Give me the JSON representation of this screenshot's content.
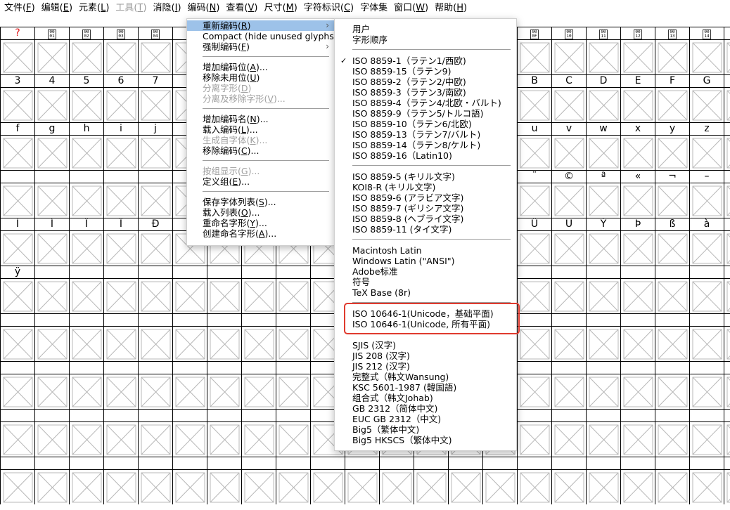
{
  "menubar": [
    {
      "label": "文件(",
      "key": "F",
      "tail": ")",
      "disabled": false
    },
    {
      "label": "编辑(",
      "key": "E",
      "tail": ")",
      "disabled": false
    },
    {
      "label": "元素(",
      "key": "L",
      "tail": ")",
      "disabled": false
    },
    {
      "label": "工具(",
      "key": "T",
      "tail": ")",
      "disabled": true
    },
    {
      "label": "消隐(",
      "key": "I",
      "tail": ")",
      "disabled": false
    },
    {
      "label": "编码(",
      "key": "N",
      "tail": ")",
      "disabled": false
    },
    {
      "label": "查看(",
      "key": "V",
      "tail": ")",
      "disabled": false
    },
    {
      "label": "尺寸(",
      "key": "M",
      "tail": ")",
      "disabled": false
    },
    {
      "label": "字符标识(",
      "key": "C",
      "tail": ")",
      "disabled": false
    },
    {
      "label": "字体集",
      "key": "",
      "tail": "",
      "disabled": false
    },
    {
      "label": "窗口(",
      "key": "W",
      "tail": ")",
      "disabled": false
    },
    {
      "label": "帮助(",
      "key": "H",
      "tail": ")",
      "disabled": false
    }
  ],
  "grid_rows": [
    [
      "?",
      "▯00\n01",
      "▯00\n02",
      "▯00\n03",
      "▯00\n04",
      "",
      "",
      "",
      "",
      "",
      "",
      "",
      "",
      "",
      "",
      "▯00\n0F",
      "▯00\n10",
      "▯00\n11",
      "▯00\n12",
      "▯00\n13",
      "▯00\n14"
    ],
    [
      "3",
      "4",
      "5",
      "6",
      "7",
      "",
      "",
      "",
      "",
      "",
      "",
      "",
      "",
      "",
      "",
      "B",
      "C",
      "D",
      "E",
      "F",
      "G"
    ],
    [
      "f",
      "g",
      "h",
      "i",
      "j",
      "",
      "",
      "",
      "",
      "",
      "",
      "",
      "",
      "",
      "",
      "u",
      "v",
      "w",
      "x",
      "y",
      "z"
    ],
    [
      "",
      "",
      "",
      "",
      "",
      "",
      "",
      "",
      "",
      "",
      "",
      "",
      "",
      "",
      "",
      "¨",
      "©",
      "ª",
      "«",
      "¬",
      "–"
    ],
    [
      "Ì",
      "Í",
      "Î",
      "Ï",
      "Ð",
      "",
      "",
      "",
      "",
      "",
      "",
      "",
      "",
      "",
      "",
      "Û",
      "Ü",
      "Ý",
      "Þ",
      "ß",
      "à"
    ],
    [
      "ÿ",
      "",
      "",
      "",
      "",
      "",
      "",
      "",
      "",
      "",
      "",
      "",
      "",
      "",
      "",
      "",
      "",
      "",
      "",
      "",
      ""
    ],
    [
      "",
      "",
      "",
      "",
      "",
      "",
      "",
      "",
      "",
      "",
      "",
      "",
      "",
      "",
      "",
      "",
      "",
      "",
      "",
      "",
      ""
    ],
    [
      "",
      "",
      "",
      "",
      "",
      "",
      "",
      "",
      "",
      "",
      "",
      "",
      "",
      "",
      "",
      "",
      "",
      "",
      "",
      "",
      ""
    ],
    [
      "",
      "",
      "",
      "",
      "",
      "",
      "",
      "",
      "",
      "",
      "",
      "",
      "",
      "",
      "",
      "",
      "",
      "",
      "",
      "",
      ""
    ],
    [
      "",
      "",
      "",
      "",
      "",
      "",
      "",
      "",
      "",
      "",
      "",
      "",
      "",
      "",
      "",
      "",
      "",
      "",
      "",
      "",
      ""
    ]
  ],
  "grid_first_red": "?",
  "encoding_menu": [
    {
      "label": "重新编码(",
      "key": "R",
      "tail": ")",
      "submenu": true,
      "highlight": true,
      "disabled": false
    },
    {
      "label": "Compact (hide unused glyphs)",
      "key": "",
      "tail": "",
      "submenu": false,
      "highlight": false,
      "disabled": false
    },
    {
      "label": "强制编码(",
      "key": "F",
      "tail": ")",
      "submenu": true,
      "highlight": false,
      "disabled": false
    },
    {
      "sep": true
    },
    {
      "label": "增加编码位(",
      "key": "A",
      "tail": ")...",
      "disabled": false
    },
    {
      "label": "移除未用位(",
      "key": "U",
      "tail": ")",
      "disabled": false
    },
    {
      "label": "分离字形(",
      "key": "D",
      "tail": ")",
      "disabled": true
    },
    {
      "label": "分离及移除字形(",
      "key": "V",
      "tail": ")...",
      "disabled": true
    },
    {
      "sep": true
    },
    {
      "label": "增加编码名(",
      "key": "N",
      "tail": ")...",
      "disabled": false
    },
    {
      "label": "载入编码(",
      "key": "L",
      "tail": ")...",
      "disabled": false
    },
    {
      "label": "生成自字体(",
      "key": "K",
      "tail": ")...",
      "disabled": true
    },
    {
      "label": "移除编码(",
      "key": "C",
      "tail": ")...",
      "disabled": false
    },
    {
      "sep": true
    },
    {
      "label": "按组显示(",
      "key": "G",
      "tail": ")...",
      "disabled": true
    },
    {
      "label": "定义组(",
      "key": "E",
      "tail": ")...",
      "disabled": false
    },
    {
      "sep": true
    },
    {
      "label": "保存字体列表(",
      "key": "S",
      "tail": ")...",
      "disabled": false
    },
    {
      "label": "载入列表(",
      "key": "O",
      "tail": ")...",
      "disabled": false
    },
    {
      "label": "重命名字形(",
      "key": "Y",
      "tail": ")...",
      "disabled": false
    },
    {
      "label": "创建命名字形(",
      "key": "A",
      "tail": ")...",
      "disabled": false
    }
  ],
  "reencode_submenu": [
    {
      "label": "用户"
    },
    {
      "label": "字形顺序"
    },
    {
      "sep": true
    },
    {
      "label": "ISO 8859-1（ラテン1/西欧)",
      "checked": true
    },
    {
      "label": "ISO 8859-15（ラテン9)"
    },
    {
      "label": "ISO 8859-2（ラテン2/中欧)"
    },
    {
      "label": "ISO 8859-3（ラテン3/南欧)"
    },
    {
      "label": "ISO 8859-4（ラテン4/北欧・バルト)"
    },
    {
      "label": "ISO 8859-9（ラテン5/トルコ語)"
    },
    {
      "label": "ISO 8859-10（ラテン6/北欧)"
    },
    {
      "label": "ISO 8859-13（ラテン7/バルト)"
    },
    {
      "label": "ISO 8859-14（ラテン8/ケルト)"
    },
    {
      "label": "ISO 8859-16（Latin10)"
    },
    {
      "sep": true
    },
    {
      "label": "ISO 8859-5 (キリル文字)"
    },
    {
      "label": "KOI8-R (キリル文字)"
    },
    {
      "label": "ISO 8859-6 (アラビア文字)"
    },
    {
      "label": "ISO 8859-7 (ギリシア文字)"
    },
    {
      "label": "ISO 8859-8 (ヘブライ文字)"
    },
    {
      "label": "ISO 8859-11 (タイ文字)"
    },
    {
      "sep": true
    },
    {
      "label": "Macintosh Latin"
    },
    {
      "label": "Windows Latin (\"ANSI\")"
    },
    {
      "label": "Adobe标准"
    },
    {
      "label": "符号"
    },
    {
      "label": "TeX Base (8r)"
    },
    {
      "sep": true
    },
    {
      "label": "ISO 10646-1(Unicode，基础平面)"
    },
    {
      "label": "ISO 10646-1(Unicode, 所有平面)"
    },
    {
      "sep": true
    },
    {
      "label": "SJIS (汉字)"
    },
    {
      "label": "JIS 208 (汉字)"
    },
    {
      "label": "JIS 212 (汉字)"
    },
    {
      "label": "完整式（韩文Wansung)"
    },
    {
      "label": "KSC 5601-1987 (韓国語)"
    },
    {
      "label": "组合式（韩文Johab)"
    },
    {
      "label": "GB 2312（简体中文)"
    },
    {
      "label": "EUC GB 2312（中文)"
    },
    {
      "label": "Big5（繁体中文)"
    },
    {
      "label": "Big5 HKSCS（繁体中文)"
    }
  ],
  "colors": {
    "highlight": "#9dc2e9",
    "annotation": "#e03a2e",
    "missing_glyph": "#e0181b"
  }
}
